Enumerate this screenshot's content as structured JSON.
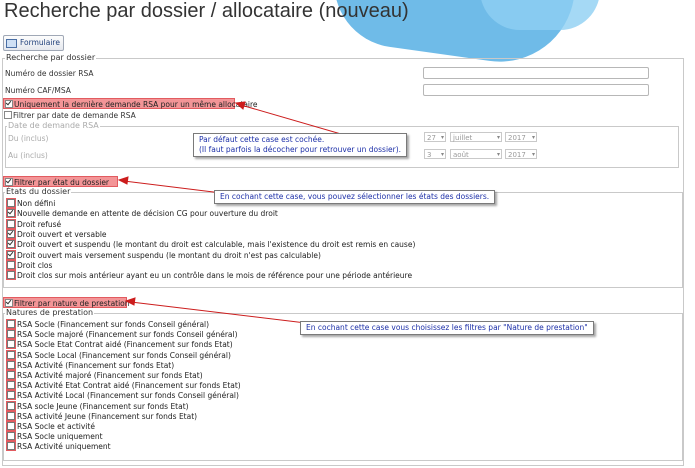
{
  "title": "Recherche par dossier / allocataire (nouveau)",
  "formulaire_button": "Formulaire",
  "search_section": {
    "legend": "Recherche par dossier",
    "numero_dossier_label": "Numéro de dossier RSA",
    "numero_dossier_value": "",
    "numero_caf_label": "Numéro CAF/MSA",
    "numero_caf_value": ""
  },
  "derniere_demande": {
    "label": "Uniquement la dernière demande RSA pour un même allocataire",
    "checked": true
  },
  "filtre_date": {
    "label": "Filtrer par date de demande RSA",
    "checked": false,
    "legend": "Date de demande RSA",
    "du_label": "Du (inclus)",
    "du_day": "27",
    "du_month": "juillet",
    "du_year": "2017",
    "au_label": "Au (inclus)",
    "au_day": "3",
    "au_month": "août",
    "au_year": "2017"
  },
  "note1_line1": "Par défaut cette case est cochée.",
  "note1_line2": "(Il faut parfois la décocher pour retrouver un dossier).",
  "filtre_etat": {
    "label": "Filtrer par état du dossier",
    "checked": true,
    "legend": "États du dossier"
  },
  "note2": "En cochant cette case, vous pouvez sélectionner les états des dossiers.",
  "etats": [
    {
      "label": "Non défini",
      "checked": false
    },
    {
      "label": "Nouvelle demande en attente de décision CG pour ouverture du droit",
      "checked": true
    },
    {
      "label": "Droit refusé",
      "checked": false
    },
    {
      "label": "Droit ouvert et versable",
      "checked": true
    },
    {
      "label": "Droit ouvert et suspendu (le montant du droit est calculable, mais l'existence du droit est remis en cause)",
      "checked": true
    },
    {
      "label": "Droit ouvert mais versement suspendu (le montant du droit n'est pas calculable)",
      "checked": true
    },
    {
      "label": "Droit clos",
      "checked": false
    },
    {
      "label": "Droit clos sur mois antérieur ayant eu un contrôle dans le mois de référence pour une période antérieure",
      "checked": false
    }
  ],
  "filtre_nature": {
    "label": "Filtrer par nature de prestation",
    "checked": true,
    "legend": "Natures de prestation"
  },
  "note3": "En cochant cette case vous choisissez les filtres par \"Nature de prestation\"",
  "natures": [
    {
      "label": "RSA Socle (Financement sur fonds Conseil général)",
      "checked": false
    },
    {
      "label": "RSA Socle majoré (Financement sur fonds Conseil général)",
      "checked": false
    },
    {
      "label": "RSA Socle Etat Contrat aidé (Financement sur fonds Etat)",
      "checked": false
    },
    {
      "label": "RSA Socle Local (Financement sur fonds Conseil général)",
      "checked": false
    },
    {
      "label": "RSA Activité (Financement sur fonds Etat)",
      "checked": false
    },
    {
      "label": "RSA Activité majoré (Financement sur fonds Etat)",
      "checked": false
    },
    {
      "label": "RSA Activité Etat Contrat aidé (Financement sur fonds Etat)",
      "checked": false
    },
    {
      "label": "RSA Activité Local (Financement sur fonds Conseil général)",
      "checked": false
    },
    {
      "label": "RSA socle Jeune (Financement sur fonds Etat)",
      "checked": false
    },
    {
      "label": "RSA activité Jeune (Financement sur fonds Etat)",
      "checked": false
    },
    {
      "label": "RSA Socle et activité",
      "checked": false
    },
    {
      "label": "RSA Socle uniquement",
      "checked": false
    },
    {
      "label": "RSA Activité uniquement",
      "checked": false
    }
  ],
  "colors": {
    "highlight": "#f39597",
    "arrow": "#cc1d1d",
    "note_text": "#1c2fa8"
  }
}
